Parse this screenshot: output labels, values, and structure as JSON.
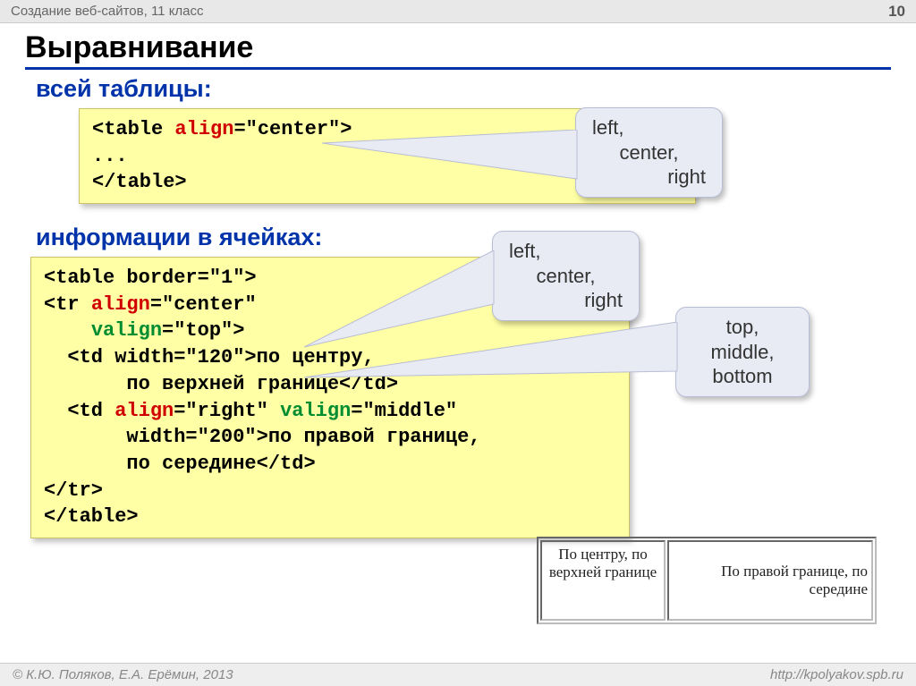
{
  "header": {
    "breadcrumb": "Создание веб-сайтов, 11 класс",
    "page_number": "10"
  },
  "title": "Выравнивание",
  "section1": {
    "heading": "всей таблицы:",
    "code_line1_before": "<table ",
    "code_line1_attr": "align",
    "code_line1_after": "=\"center\">",
    "code_line2": "...",
    "code_line3": "</table>"
  },
  "balloon1": {
    "l1": "left,",
    "l2": "center,",
    "l3": "right"
  },
  "section2": {
    "heading": "информации в ячейках:"
  },
  "balloon2": {
    "l1": "left,",
    "l2": "center,",
    "l3": "right"
  },
  "balloon3": {
    "l1": "top,",
    "l2": "middle,",
    "l3": "bottom"
  },
  "code2": {
    "l1": "<table border=\"1\">",
    "l2_a": "<tr ",
    "l2_attr": "align",
    "l2_b": "=\"center\"",
    "l3_a": "    ",
    "l3_attr": "valign",
    "l3_b": "=\"top\">",
    "l4": "  <td width=\"120\">по центру,",
    "l5": "       по верхней границе</td>",
    "l6_a": "  <td ",
    "l6_attr1": "align",
    "l6_b": "=\"right\" ",
    "l6_attr2": "valign",
    "l6_c": "=\"middle\"",
    "l7": "       width=\"200\">по правой границе,",
    "l8": "       по середине</td>",
    "l9": "</tr>",
    "l10": "</table>"
  },
  "demo": {
    "cell1": "По центру, по верхней границе",
    "cell2": "По правой границе, по середине"
  },
  "footer": {
    "copyright": "© К.Ю. Поляков, Е.А. Ерёмин, 2013",
    "url": "http://kpolyakov.spb.ru"
  }
}
